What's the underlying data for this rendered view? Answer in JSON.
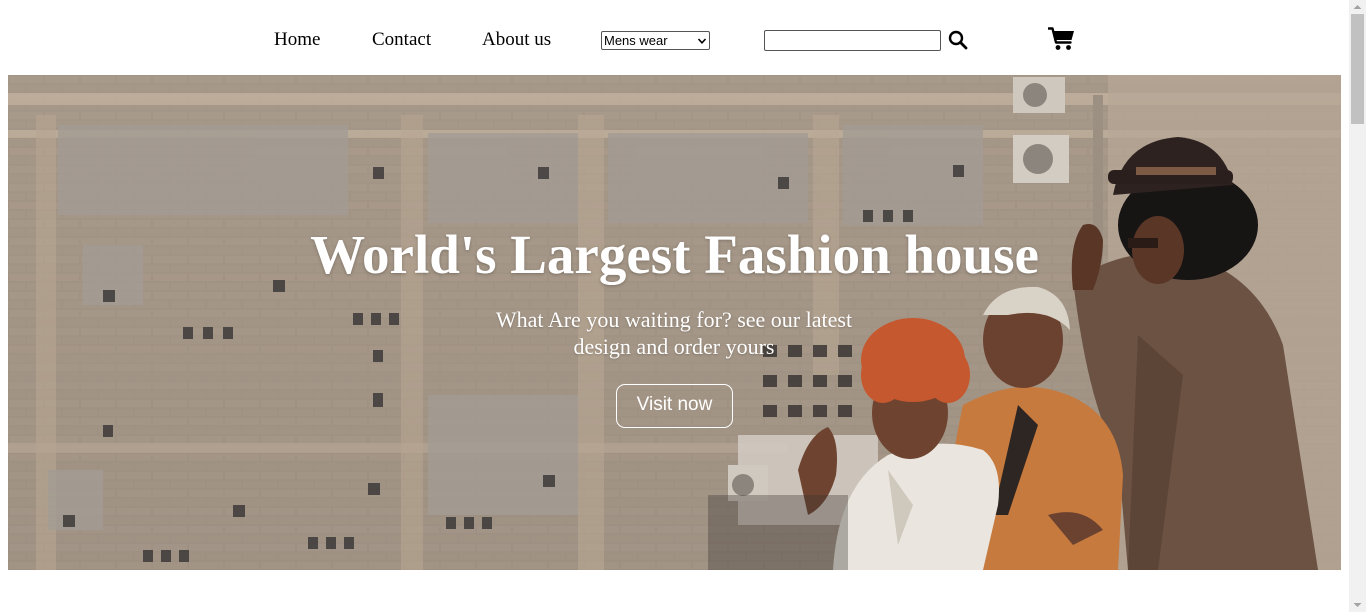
{
  "nav": {
    "home_label": "Home",
    "contact_label": "Contact",
    "about_label": "About us",
    "category_select": {
      "selected": "Mens wear"
    },
    "search": {
      "value": "",
      "placeholder": "",
      "icon": "search-icon"
    },
    "cart": {
      "icon": "cart-icon"
    }
  },
  "hero": {
    "title": "World's Largest Fashion house",
    "subtitle": "What Are you waiting for? see our latest design and order yours",
    "cta_label": "Visit now",
    "image": "fashion-models-photo"
  },
  "colors": {
    "text": "#000000",
    "hero_text": "#ffffff",
    "scrollbar_track": "#f1f1f1",
    "scrollbar_thumb": "#c1c1c1"
  }
}
